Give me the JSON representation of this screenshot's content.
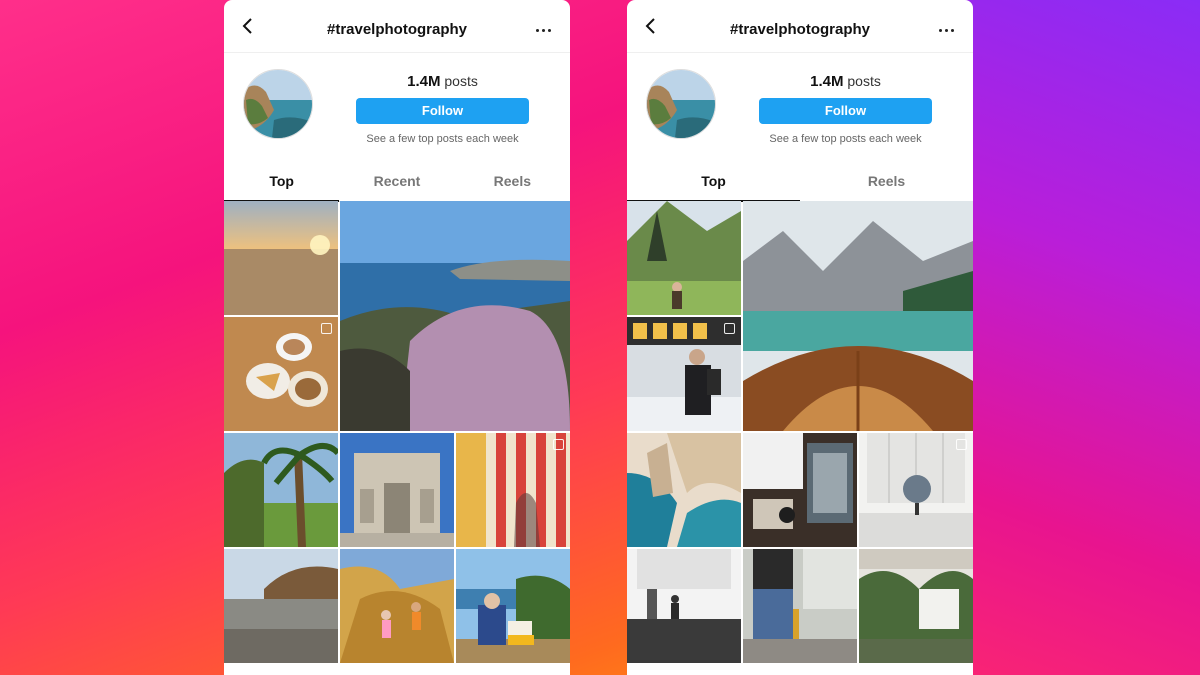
{
  "colors": {
    "accent": "#1ea1f2",
    "bg_left": "#ff2f8a",
    "bg_right": "#8a2cf6"
  },
  "screens": [
    {
      "header": {
        "title": "#travelphotography",
        "back_icon": "chevron-left",
        "more_icon": "ellipsis"
      },
      "profile": {
        "posts_count": "1.4M",
        "posts_word": "posts",
        "follow_label": "Follow",
        "subtext": "See a few top posts each week"
      },
      "tabs": [
        "Top",
        "Recent",
        "Reels"
      ],
      "active_tab": "Top"
    },
    {
      "header": {
        "title": "#travelphotography",
        "back_icon": "chevron-left",
        "more_icon": "ellipsis"
      },
      "profile": {
        "posts_count": "1.4M",
        "posts_word": "posts",
        "follow_label": "Follow",
        "subtext": "See a few top posts each week"
      },
      "tabs": [
        "Top",
        "Reels"
      ],
      "active_tab": "Top"
    }
  ]
}
